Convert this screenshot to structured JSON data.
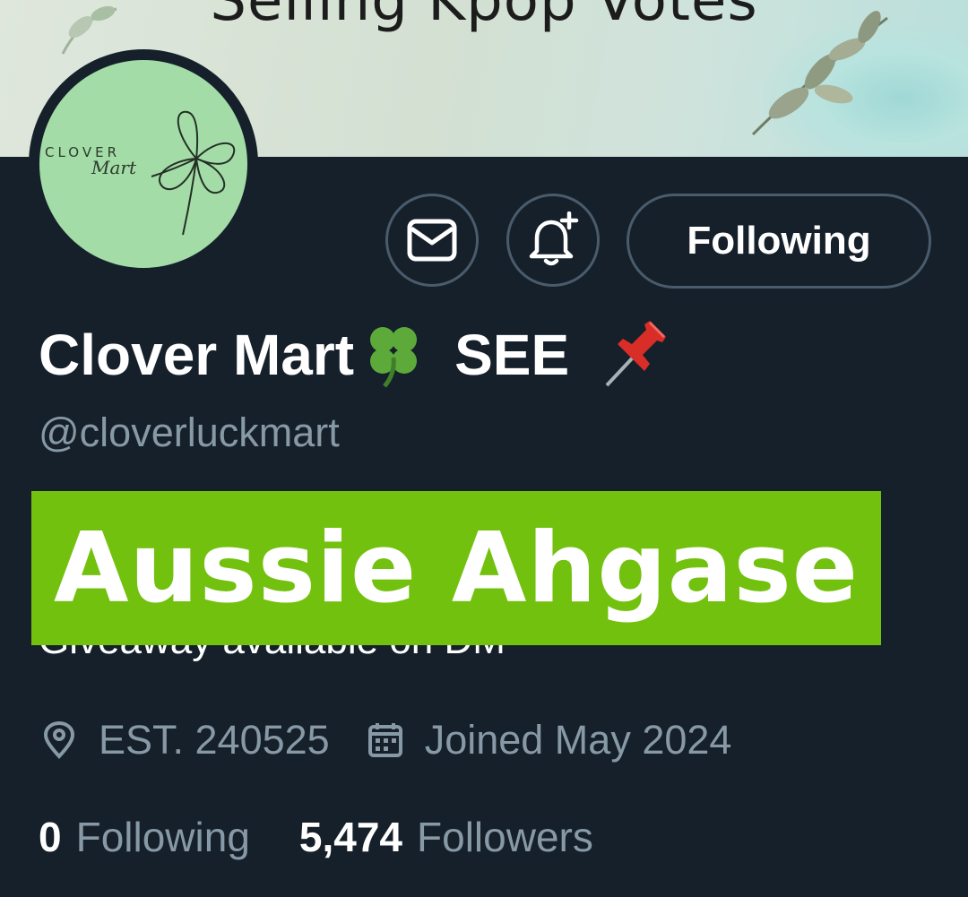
{
  "banner": {
    "text": "Selling Kpop Votes"
  },
  "avatar": {
    "logo_word": "CLOVER",
    "logo_script": "Mart"
  },
  "actions": {
    "message_icon": "mail-icon",
    "notify_icon": "bell-plus-icon",
    "following_label": "Following"
  },
  "profile": {
    "name": "Clover Mart",
    "name_suffix": "SEE",
    "name_emojis": [
      "four-leaf-clover-icon",
      "pushpin-icon"
    ],
    "handle": "@cloverluckmart",
    "bio_visible": "Giveaway available on DM",
    "overlay_label": "Aussie Ahgase",
    "location_icon": "location-pin-icon",
    "location": "EST. 240525",
    "joined_icon": "calendar-icon",
    "joined": "Joined May 2024"
  },
  "stats": {
    "following_count": "0",
    "following_label": "Following",
    "followers_count": "5,474",
    "followers_label": "Followers"
  },
  "colors": {
    "background": "#15202b",
    "secondary_text": "#8899a6",
    "button_border": "#4a5b6b",
    "overlay_green": "#73c10f",
    "avatar_green": "#a4dca8"
  }
}
